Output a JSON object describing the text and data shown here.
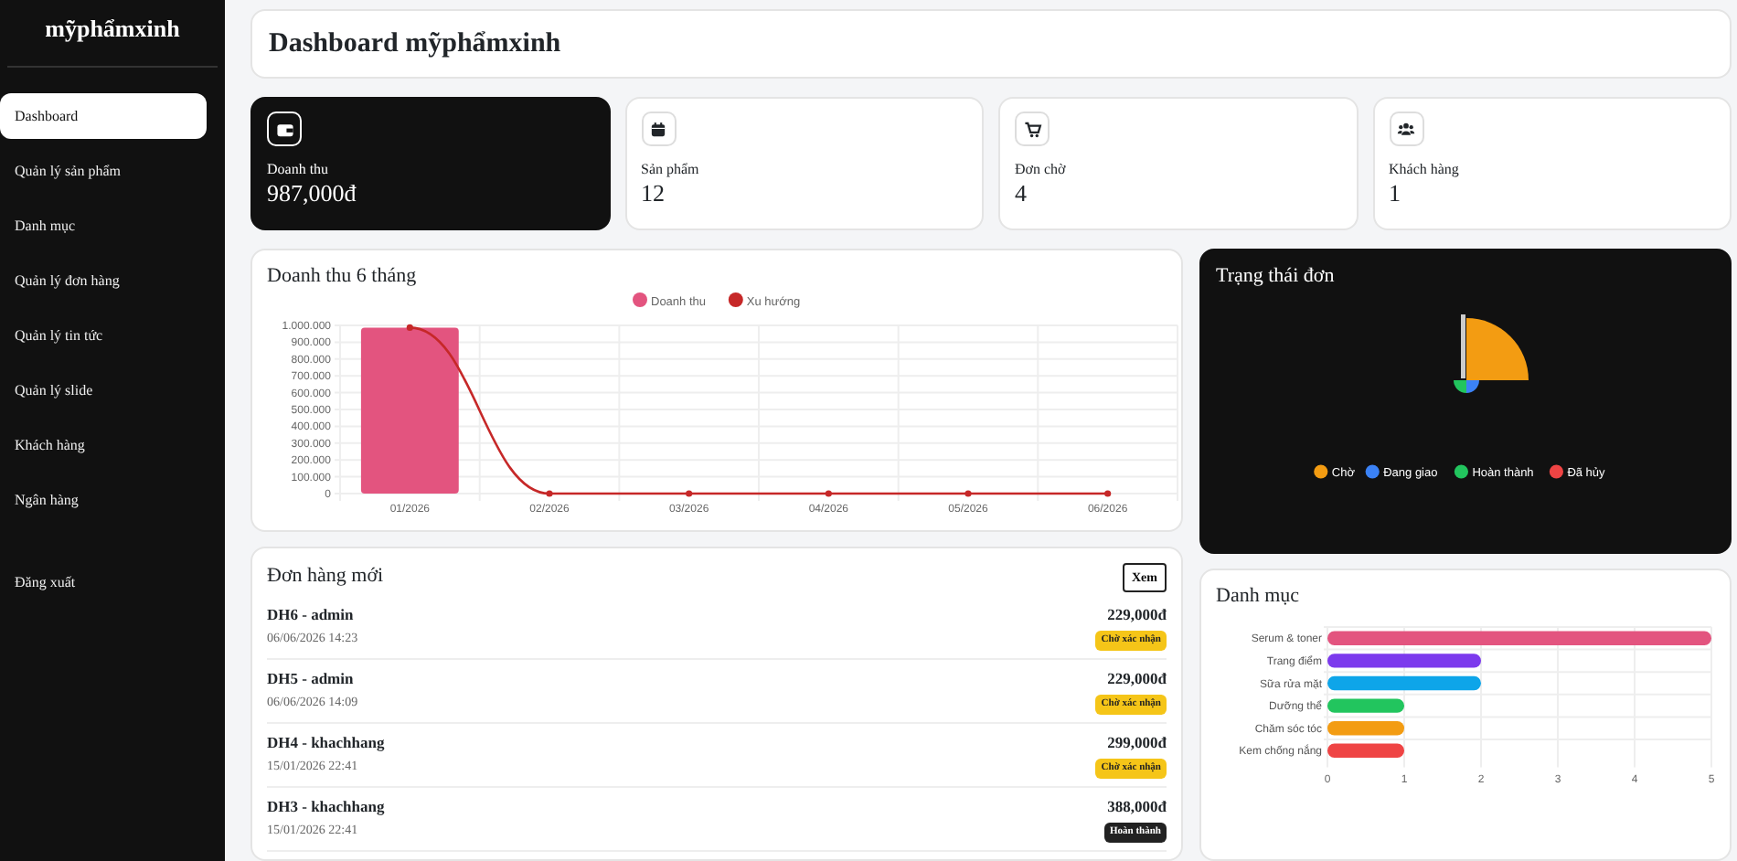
{
  "sidebar": {
    "brand": "mỹphẩmxinh",
    "items": [
      {
        "label": "Dashboard",
        "selected": true
      },
      {
        "label": "Quản lý sản phẩm",
        "selected": false
      },
      {
        "label": "Danh mục",
        "selected": false
      },
      {
        "label": "Quản lý đơn hàng",
        "selected": false
      },
      {
        "label": "Quản lý tin tức",
        "selected": false
      },
      {
        "label": "Quản lý slide",
        "selected": false
      },
      {
        "label": "Khách hàng",
        "selected": false
      },
      {
        "label": "Ngân hàng",
        "selected": false
      }
    ],
    "logout": "Đăng xuất"
  },
  "header": {
    "title": "Dashboard mỹphẩmxinh"
  },
  "stats": [
    {
      "label": "Doanh thu",
      "value": "987,000đ",
      "highlighted": true
    },
    {
      "label": "Sản phẩm",
      "value": "12",
      "highlighted": false
    },
    {
      "label": "Đơn chờ",
      "value": "4",
      "highlighted": false
    },
    {
      "label": "Khách hàng",
      "value": "1",
      "highlighted": false
    }
  ],
  "revenue": {
    "title": "Doanh thu 6 tháng",
    "chart_data": {
      "type": "bar",
      "categories": [
        "01/2026",
        "02/2026",
        "03/2026",
        "04/2026",
        "05/2026",
        "06/2026"
      ],
      "series": [
        {
          "name": "Doanh thu",
          "type": "bar",
          "color": "#e3547f",
          "values": [
            987000,
            0,
            0,
            0,
            0,
            0
          ]
        },
        {
          "name": "Xu hướng",
          "type": "line",
          "color": "#c62828",
          "marker": true,
          "values": [
            987000,
            0,
            0,
            0,
            0,
            0
          ]
        }
      ],
      "ylim": [
        0,
        1000000
      ],
      "grid": true,
      "legend": "top",
      "yticks": [
        {
          "value": 0,
          "label": "0"
        },
        {
          "value": 100000,
          "label": "100.000"
        },
        {
          "value": 200000,
          "label": "200.000"
        },
        {
          "value": 300000,
          "label": "300.000"
        },
        {
          "value": 400000,
          "label": "400.000"
        },
        {
          "value": 500000,
          "label": "500.000"
        },
        {
          "value": 600000,
          "label": "600.000"
        },
        {
          "value": 700000,
          "label": "700.000"
        },
        {
          "value": 800000,
          "label": "800.000"
        },
        {
          "value": 900000,
          "label": "900.000"
        },
        {
          "value": 1000000,
          "label": "1.000.000"
        }
      ]
    }
  },
  "status_chart": {
    "title": "Trạng thái đơn",
    "legend": [
      {
        "label": "Chờ",
        "color": "#f39c12"
      },
      {
        "label": "Đang giao",
        "color": "#3b82f6"
      },
      {
        "label": "Hoàn thành",
        "color": "#22c55e"
      },
      {
        "label": "Đã hủy",
        "color": "#ef4444"
      }
    ]
  },
  "orders": {
    "title": "Đơn hàng mới",
    "button": "Xem",
    "rows": [
      {
        "code": "DH6 - admin",
        "time": "06/06/2026 14:23",
        "amount": "229,000đ",
        "status": "Chờ xác nhận",
        "kind": "pending"
      },
      {
        "code": "DH5 - admin",
        "time": "06/06/2026 14:09",
        "amount": "229,000đ",
        "status": "Chờ xác nhận",
        "kind": "pending"
      },
      {
        "code": "DH4 - khachhang",
        "time": "15/01/2026 22:41",
        "amount": "299,000đ",
        "status": "Chờ xác nhận",
        "kind": "pending"
      },
      {
        "code": "DH3 - khachhang",
        "time": "15/01/2026 22:41",
        "amount": "388,000đ",
        "status": "Hoàn thành",
        "kind": "done"
      }
    ]
  },
  "categories": {
    "title": "Danh mục",
    "chart_data": {
      "type": "bar",
      "orientation": "horizontal",
      "categories": [
        "Serum & toner",
        "Trang điểm",
        "Sữa rửa mặt",
        "Dưỡng thể",
        "Chăm sóc tóc",
        "Kem chống nắng"
      ],
      "values": [
        5,
        2,
        2,
        1,
        1,
        1
      ],
      "colors": [
        "#e3547f",
        "#7c3aed",
        "#0ea5e9",
        "#22c55e",
        "#f39c12",
        "#ef4444"
      ],
      "xlim": [
        0,
        5
      ],
      "xticks": [
        0,
        1,
        2,
        3,
        4,
        5
      ],
      "grid": true
    }
  }
}
